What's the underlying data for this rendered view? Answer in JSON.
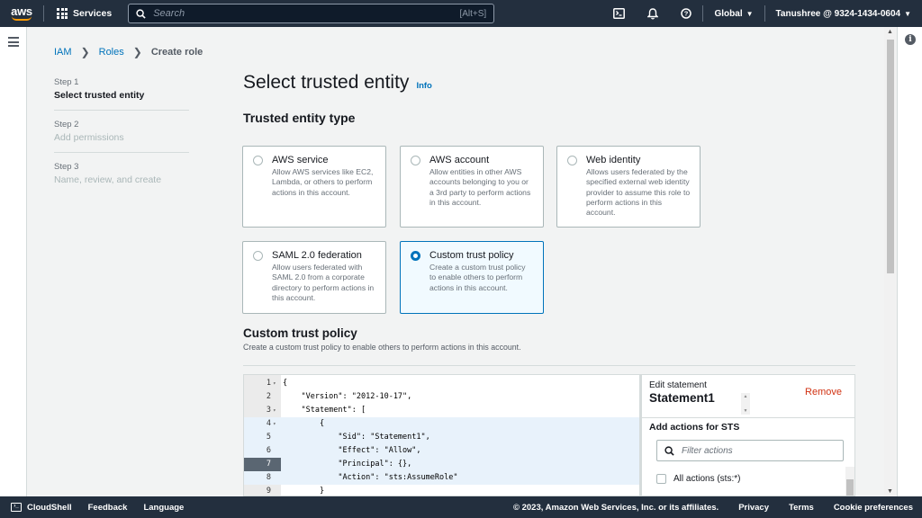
{
  "topnav": {
    "logo_text": "aws",
    "services_label": "Services",
    "search_placeholder": "Search",
    "search_shortcut": "[Alt+S]",
    "region": "Global",
    "account": "Tanushree @ 9324-1434-0604"
  },
  "breadcrumb": {
    "items": [
      "IAM",
      "Roles"
    ],
    "current": "Create role"
  },
  "steps": [
    {
      "num": "Step 1",
      "name": "Select trusted entity"
    },
    {
      "num": "Step 2",
      "name": "Add permissions"
    },
    {
      "num": "Step 3",
      "name": "Name, review, and create"
    }
  ],
  "main": {
    "title": "Select trusted entity",
    "info": "Info",
    "entity_type_heading": "Trusted entity type",
    "cards": [
      {
        "title": "AWS service",
        "desc": "Allow AWS services like EC2, Lambda, or others to perform actions in this account.",
        "selected": false
      },
      {
        "title": "AWS account",
        "desc": "Allow entities in other AWS accounts belonging to you or a 3rd party to perform actions in this account.",
        "selected": false
      },
      {
        "title": "Web identity",
        "desc": "Allows users federated by the specified external web identity provider to assume this role to perform actions in this account.",
        "selected": false
      },
      {
        "title": "SAML 2.0 federation",
        "desc": "Allow users federated with SAML 2.0 from a corporate directory to perform actions in this account.",
        "selected": false
      },
      {
        "title": "Custom trust policy",
        "desc": "Create a custom trust policy to enable others to perform actions in this account.",
        "selected": true
      }
    ],
    "ctp_title": "Custom trust policy",
    "ctp_desc": "Create a custom trust policy to enable others to perform actions in this account."
  },
  "editor": {
    "lines": [
      {
        "n": "1",
        "fold": "▾",
        "code": "{"
      },
      {
        "n": "2",
        "fold": "",
        "code": "    \"Version\": \"2012-10-17\","
      },
      {
        "n": "3",
        "fold": "▾",
        "code": "    \"Statement\": ["
      },
      {
        "n": "4",
        "fold": "▾",
        "code": "        {"
      },
      {
        "n": "5",
        "fold": "",
        "code": "            \"Sid\": \"Statement1\","
      },
      {
        "n": "6",
        "fold": "",
        "code": "            \"Effect\": \"Allow\","
      },
      {
        "n": "7",
        "fold": "",
        "code": "            \"Principal\": {},"
      },
      {
        "n": "8",
        "fold": "",
        "code": "            \"Action\": \"sts:AssumeRole\""
      },
      {
        "n": "9",
        "fold": "",
        "code": "        }"
      }
    ]
  },
  "statement_panel": {
    "edit_label": "Edit statement",
    "name": "Statement1",
    "remove_label": "Remove",
    "add_actions_label": "Add actions for STS",
    "filter_placeholder": "Filter actions",
    "all_actions_label": "All actions (sts:*)"
  },
  "footer": {
    "cloudshell": "CloudShell",
    "feedback": "Feedback",
    "language": "Language",
    "copyright": "© 2023, Amazon Web Services, Inc. or its affiliates.",
    "privacy": "Privacy",
    "terms": "Terms",
    "cookies": "Cookie preferences"
  },
  "colors": {
    "nav_bg": "#232f3e",
    "link": "#0073bb",
    "selected_border": "#0073bb",
    "remove": "#d13212"
  },
  "icons": [
    "grid-icon",
    "search-icon",
    "cloudshell-icon",
    "bell-icon",
    "help-icon",
    "menu-icon",
    "info-icon"
  ]
}
